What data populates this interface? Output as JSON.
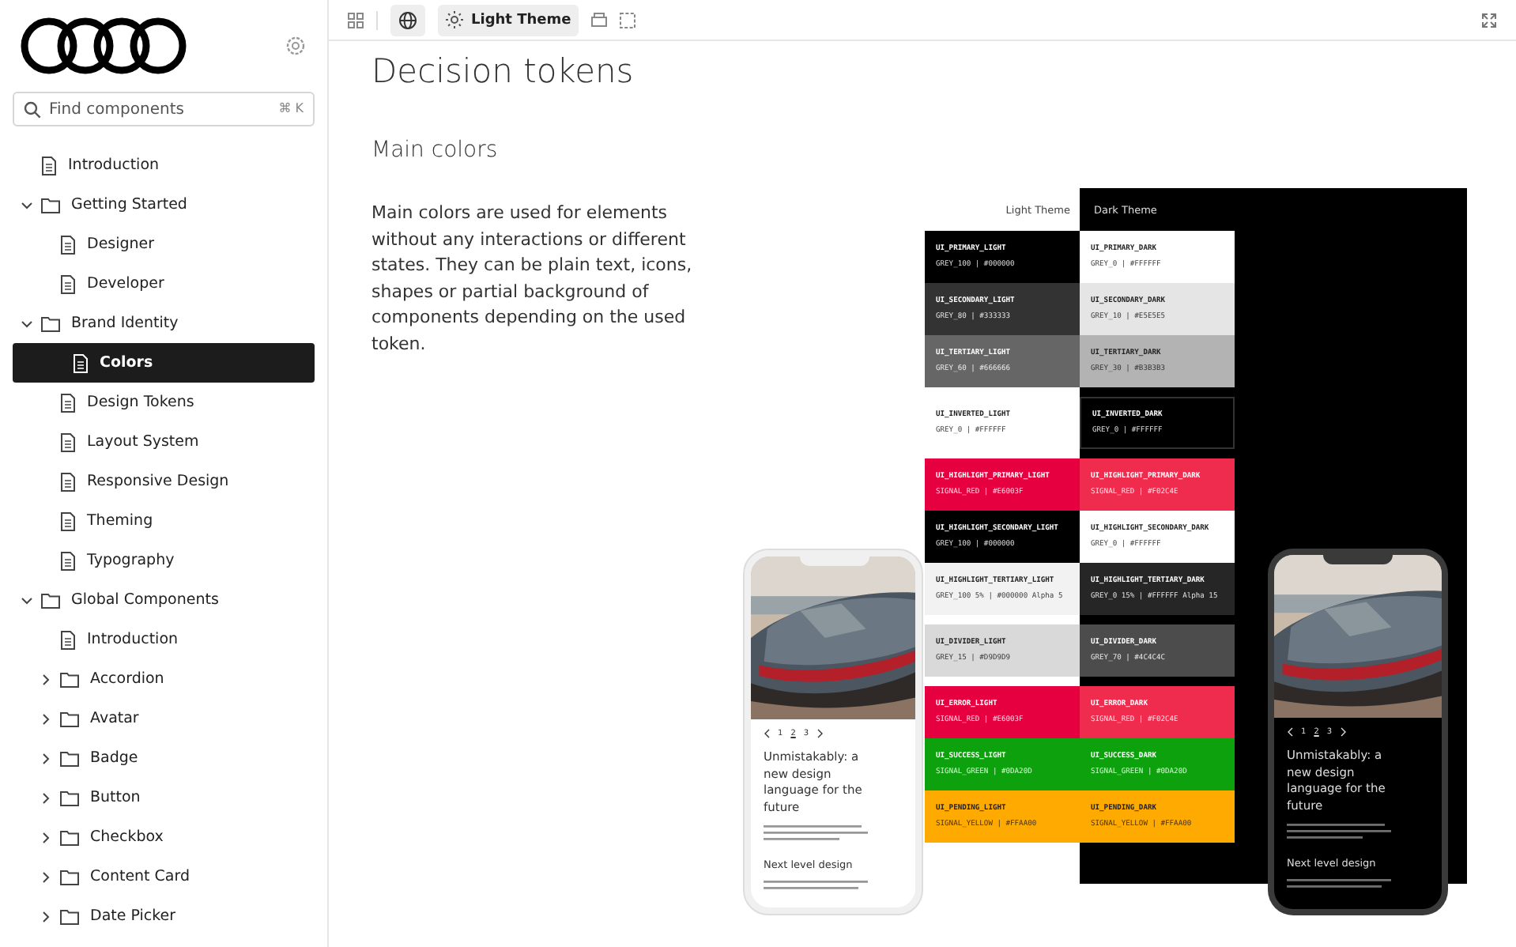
{
  "sidebar": {
    "search": {
      "placeholder": "Find components",
      "shortcut": "⌘ K"
    },
    "tree": [
      {
        "label": "Introduction",
        "kind": "page",
        "selected": false
      },
      {
        "label": "Getting Started",
        "kind": "folder",
        "expanded": true,
        "selected": false,
        "children": [
          {
            "label": "Designer",
            "kind": "page",
            "selected": false
          },
          {
            "label": "Developer",
            "kind": "page",
            "selected": false
          }
        ]
      },
      {
        "label": "Brand Identity",
        "kind": "folder",
        "expanded": true,
        "selected": false,
        "children": [
          {
            "label": "Colors",
            "kind": "page",
            "selected": true
          },
          {
            "label": "Design Tokens",
            "kind": "page",
            "selected": false
          },
          {
            "label": "Layout System",
            "kind": "page",
            "selected": false
          },
          {
            "label": "Responsive Design",
            "kind": "page",
            "selected": false
          },
          {
            "label": "Theming",
            "kind": "page",
            "selected": false
          },
          {
            "label": "Typography",
            "kind": "page",
            "selected": false
          }
        ]
      },
      {
        "label": "Global Components",
        "kind": "folder",
        "expanded": true,
        "selected": false,
        "children": [
          {
            "label": "Introduction",
            "kind": "page",
            "selected": false
          },
          {
            "label": "Accordion",
            "kind": "folder",
            "expanded": false,
            "selected": false
          },
          {
            "label": "Avatar",
            "kind": "folder",
            "expanded": false,
            "selected": false
          },
          {
            "label": "Badge",
            "kind": "folder",
            "expanded": false,
            "selected": false
          },
          {
            "label": "Button",
            "kind": "folder",
            "expanded": false,
            "selected": false
          },
          {
            "label": "Checkbox",
            "kind": "folder",
            "expanded": false,
            "selected": false
          },
          {
            "label": "Content Card",
            "kind": "folder",
            "expanded": false,
            "selected": false
          },
          {
            "label": "Date Picker",
            "kind": "folder",
            "expanded": false,
            "selected": false
          }
        ]
      }
    ]
  },
  "toolbar": {
    "theme_button": "Light Theme"
  },
  "content": {
    "title": "Decision tokens",
    "section_title": "Main colors",
    "description": "Main colors are used for elements without any interactions or different states. They can be plain text, icons, shapes or partial background of components depending on the used token.",
    "theme_headers": [
      "Light Theme",
      "Dark Theme"
    ],
    "swatch_groups": [
      [
        {
          "light": {
            "token": "UI_PRIMARY_LIGHT",
            "value": "GREY_100 | #000000",
            "color": "#000000"
          },
          "dark": {
            "token": "UI_PRIMARY_DARK",
            "value": "GREY_0 | #FFFFFF",
            "color": "#ffffff"
          }
        },
        {
          "light": {
            "token": "UI_SECONDARY_LIGHT",
            "value": "GREY_80 | #333333",
            "color": "#333333"
          },
          "dark": {
            "token": "UI_SECONDARY_DARK",
            "value": "GREY_10 | #E5E5E5",
            "color": "#e5e5e5"
          }
        },
        {
          "light": {
            "token": "UI_TERTIARY_LIGHT",
            "value": "GREY_60 | #666666",
            "color": "#666666"
          },
          "dark": {
            "token": "UI_TERTIARY_DARK",
            "value": "GREY_30 | #B3B3B3",
            "color": "#b3b3b3"
          }
        }
      ],
      [
        {
          "light": {
            "token": "UI_INVERTED_LIGHT",
            "value": "GREY_0 | #FFFFFF",
            "color": "#ffffff"
          },
          "dark": {
            "token": "UI_INVERTED_DARK",
            "value": "GREY_0 | #FFFFFF",
            "color": "#000000"
          }
        }
      ],
      [
        {
          "light": {
            "token": "UI_HIGHLIGHT_PRIMARY_LIGHT",
            "value": "SIGNAL_RED | #E6003F",
            "color": "#e6003f"
          },
          "dark": {
            "token": "UI_HIGHLIGHT_PRIMARY_DARK",
            "value": "SIGNAL_RED | #F02C4E",
            "color": "#f02c4e"
          }
        },
        {
          "light": {
            "token": "UI_HIGHLIGHT_SECONDARY_LIGHT",
            "value": "GREY_100 | #000000",
            "color": "#000000"
          },
          "dark": {
            "token": "UI_HIGHLIGHT_SECONDARY_DARK",
            "value": "GREY_0 | #FFFFFF",
            "color": "#ffffff"
          }
        },
        {
          "light": {
            "token": "UI_HIGHLIGHT_TERTIARY_LIGHT",
            "value": "GREY_100 5% | #000000 Alpha 5",
            "color": "#f2f2f2"
          },
          "dark": {
            "token": "UI_HIGHLIGHT_TERTIARY_DARK",
            "value": "GREY_0 15% | #FFFFFF Alpha 15",
            "color": "#262626"
          }
        }
      ],
      [
        {
          "light": {
            "token": "UI_DIVIDER_LIGHT",
            "value": "GREY_15 | #D9D9D9",
            "color": "#d9d9d9"
          },
          "dark": {
            "token": "UI_DIVIDER_DARK",
            "value": "GREY_70 | #4C4C4C",
            "color": "#4c4c4c"
          }
        }
      ],
      [
        {
          "light": {
            "token": "UI_ERROR_LIGHT",
            "value": "SIGNAL_RED | #E6003F",
            "color": "#e6003f"
          },
          "dark": {
            "token": "UI_ERROR_DARK",
            "value": "SIGNAL_RED | #F02C4E",
            "color": "#f02c4e"
          }
        },
        {
          "light": {
            "token": "UI_SUCCESS_LIGHT",
            "value": "SIGNAL_GREEN | #0DA20D",
            "color": "#0da20d"
          },
          "dark": {
            "token": "UI_SUCCESS_DARK",
            "value": "SIGNAL_GREEN | #0DA20D",
            "color": "#0da20d"
          }
        },
        {
          "light": {
            "token": "UI_PENDING_LIGHT",
            "value": "SIGNAL_YELLOW | #FFAA00",
            "color": "#ffaa00"
          },
          "dark": {
            "token": "UI_PENDING_DARK",
            "value": "SIGNAL_YELLOW | #FFAA00",
            "color": "#ffaa00"
          }
        }
      ]
    ],
    "phones": [
      {
        "dark": false,
        "pages": [
          {
            "label": "1",
            "selected": false
          },
          {
            "label": "2",
            "selected": true
          },
          {
            "label": "3",
            "selected": false
          }
        ],
        "headline": "Unmistakably: a new design language for the future",
        "subheading": "Next level design"
      },
      {
        "dark": true,
        "pages": [
          {
            "label": "1",
            "selected": false
          },
          {
            "label": "2",
            "selected": true
          },
          {
            "label": "3",
            "selected": false
          }
        ],
        "headline": "Unmistakably: a new design language for the future",
        "subheading": "Next level design"
      }
    ]
  }
}
